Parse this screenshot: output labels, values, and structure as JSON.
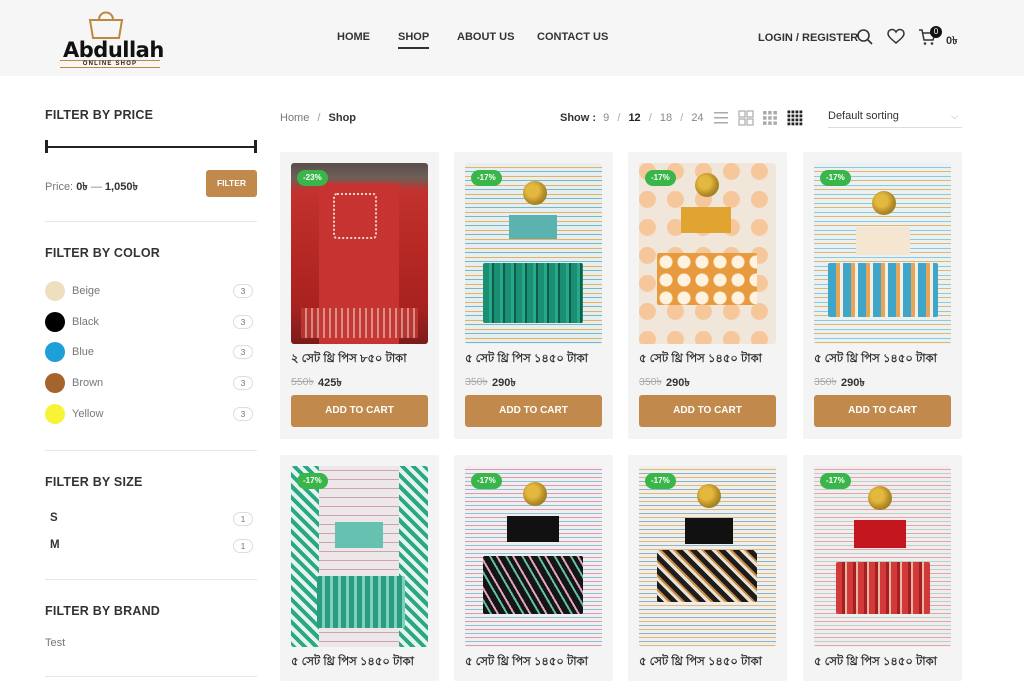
{
  "header": {
    "logo_text": "Abdullah",
    "logo_sub": "ONLINE SHOP",
    "nav": [
      "HOME",
      "SHOP",
      "ABOUT US",
      "CONTACT US"
    ],
    "login": "LOGIN / REGISTER",
    "cart_count": "0",
    "cart_total": "0৳"
  },
  "sidebar": {
    "price": {
      "title": "FILTER BY PRICE",
      "price_label": "Price:",
      "min": "0৳",
      "dash": "—",
      "max": "1,050৳",
      "button": "FILTER"
    },
    "color": {
      "title": "FILTER BY COLOR",
      "items": [
        {
          "name": "Beige",
          "count": "3",
          "hex": "#efdfc1"
        },
        {
          "name": "Black",
          "count": "3",
          "hex": "#000000"
        },
        {
          "name": "Blue",
          "count": "3",
          "hex": "#1f9fd8"
        },
        {
          "name": "Brown",
          "count": "3",
          "hex": "#a5642c"
        },
        {
          "name": "Yellow",
          "count": "3",
          "hex": "#f7f337"
        }
      ]
    },
    "size": {
      "title": "FILTER BY SIZE",
      "items": [
        {
          "name": "S",
          "count": "1"
        },
        {
          "name": "M",
          "count": "1"
        }
      ]
    },
    "brand": {
      "title": "FILTER BY BRAND",
      "items": [
        "Test"
      ]
    }
  },
  "toolbar": {
    "breadcrumb_home": "Home",
    "breadcrumb_sep": "/",
    "breadcrumb_current": "Shop",
    "show_label": "Show :",
    "show_options": [
      "9",
      "12",
      "18",
      "24"
    ],
    "sorting": "Default sorting"
  },
  "products": [
    {
      "badge": "-23%",
      "name": "২ সেট থ্রি পিস ৮৫০ টাকা",
      "old_price": "550৳",
      "price": "425৳",
      "button": "ADD TO CART"
    },
    {
      "badge": "-17%",
      "name": "৫ সেট থ্রি পিস ১৪৫০ টাকা",
      "old_price": "350৳",
      "price": "290৳",
      "button": "ADD TO CART"
    },
    {
      "badge": "-17%",
      "name": "৫ সেট থ্রি পিস ১৪৫০ টাকা",
      "old_price": "350৳",
      "price": "290৳",
      "button": "ADD TO CART"
    },
    {
      "badge": "-17%",
      "name": "৫ সেট থ্রি পিস ১৪৫০ টাকা",
      "old_price": "350৳",
      "price": "290৳",
      "button": "ADD TO CART"
    },
    {
      "badge": "-17%",
      "name": "৫ সেট থ্রি পিস ১৪৫০ টাকা"
    },
    {
      "badge": "-17%",
      "name": "৫ সেট থ্রি পিস ১৪৫০ টাকা"
    },
    {
      "badge": "-17%",
      "name": "৫ সেট থ্রি পিস ১৪৫০ টাকা"
    },
    {
      "badge": "-17%",
      "name": "৫ সেট থ্রি পিস ১৪৫০ টাকা"
    }
  ],
  "colors": {
    "accent": "#c1894b",
    "sale_badge": "#39b54a"
  }
}
